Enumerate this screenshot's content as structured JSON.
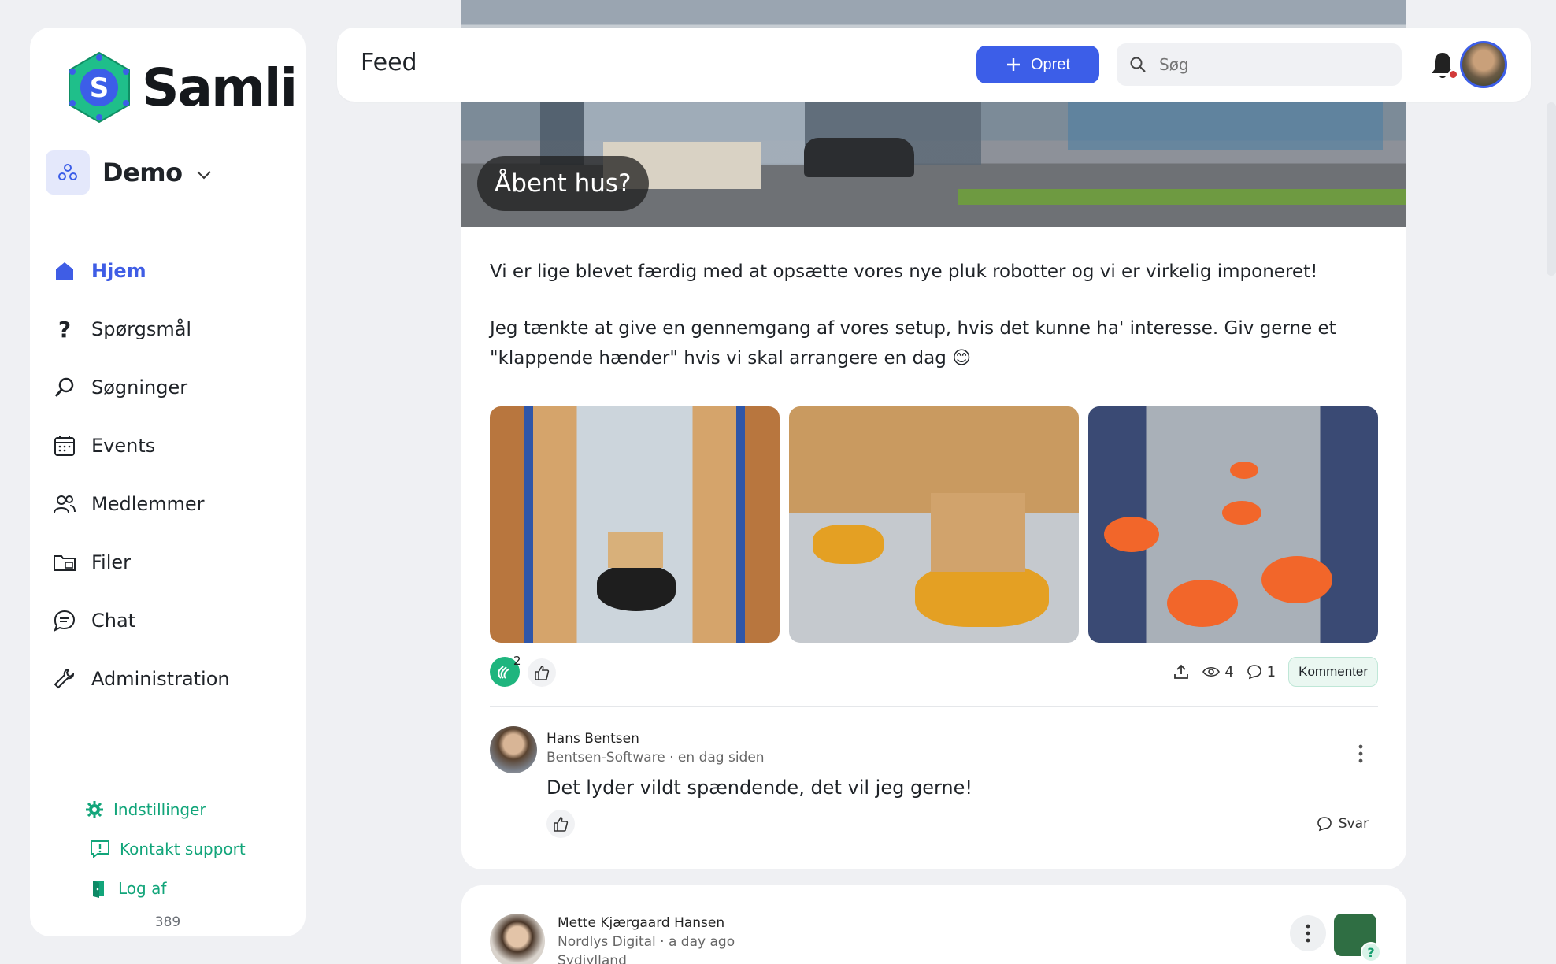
{
  "app": {
    "brand": "Samli",
    "version": "389"
  },
  "workspace": {
    "name": "Demo"
  },
  "nav": {
    "items": [
      {
        "label": "Hjem",
        "icon": "home-icon",
        "active": true
      },
      {
        "label": "Spørgsmål",
        "icon": "question-icon"
      },
      {
        "label": "Søgninger",
        "icon": "search-icon"
      },
      {
        "label": "Events",
        "icon": "calendar-icon"
      },
      {
        "label": "Medlemmer",
        "icon": "members-icon"
      },
      {
        "label": "Filer",
        "icon": "folder-icon"
      },
      {
        "label": "Chat",
        "icon": "chat-icon"
      },
      {
        "label": "Administration",
        "icon": "wrench-icon"
      }
    ],
    "footer": [
      {
        "label": "Indstillinger",
        "icon": "gear-icon"
      },
      {
        "label": "Kontakt support",
        "icon": "support-icon"
      },
      {
        "label": "Log af",
        "icon": "logout-icon"
      }
    ]
  },
  "header": {
    "title": "Feed",
    "create_label": "Opret",
    "search_placeholder": "Søg"
  },
  "post": {
    "hero_label": "Åbent hus?",
    "paragraphs": [
      "Vi er lige blevet færdig med at opsætte vores nye pluk robotter og vi er virkelig imponeret!",
      "Jeg tænkte at give en gennemgang af vores setup, hvis det kunne ha' interesse. Giv gerne et \"klappende hænder\" hvis vi skal arrangere en dag 😊"
    ],
    "clap_count": "2",
    "views": "4",
    "comments": "1",
    "comment_button": "Kommenter",
    "comment": {
      "author": "Hans Bentsen",
      "meta": "Bentsen-Software · en dag siden",
      "text": "Det lyder vildt spændende, det vil jeg gerne!",
      "reply_label": "Svar"
    }
  },
  "next_post": {
    "author": "Mette Kjærgaard Hansen",
    "meta": "Nordlys Digital · a day ago",
    "region": "Sydjylland",
    "group_badge": "?"
  },
  "colors": {
    "accent": "#3c5ee8",
    "green": "#12a57a",
    "background": "#eff0f3"
  }
}
